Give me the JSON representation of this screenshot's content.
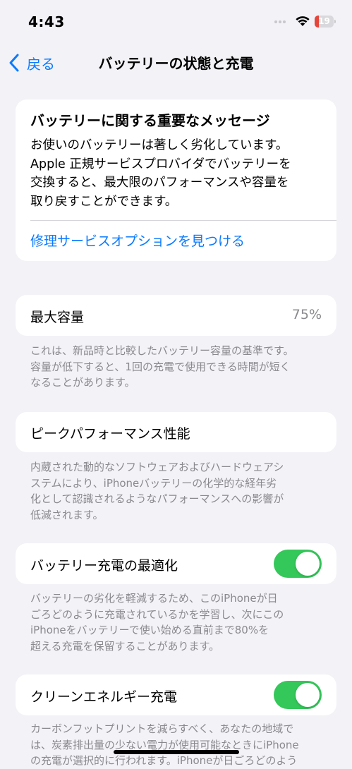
{
  "status_bar": {
    "time": "4:43",
    "battery_level": "19"
  },
  "nav": {
    "back_label": "戻る",
    "title": "バッテリーの状態と充電"
  },
  "message_card": {
    "title": "バッテリーに関する重要なメッセージ",
    "body_lines": [
      "お使いのバッテリーは著しく劣化しています。",
      "Apple 正規サービスプロバイダでバッテリーを",
      "交換すると、最大限のパフォーマンスや容量を",
      "取り戻すことができます。"
    ],
    "link": "修理サービスオプションを見つける"
  },
  "max_capacity": {
    "label": "最大容量",
    "value": "75%",
    "note_lines": [
      "これは、新品時と比較したバッテリー容量の基準です。",
      "容量が低下すると、1回の充電で使用できる時間が短く",
      "なることがあります。"
    ]
  },
  "peak_performance": {
    "label": "ピークパフォーマンス性能",
    "note_lines": [
      "内蔵された動的なソフトウェアおよびハードウェアシ",
      "ステムにより、iPhoneバッテリーの化学的な経年劣",
      "化として認識されるようなパフォーマンスへの影響が",
      "低減されます。"
    ]
  },
  "optimized_charging": {
    "label": "バッテリー充電の最適化",
    "enabled": true,
    "note_lines": [
      "バッテリーの劣化を軽減するため、このiPhoneが日",
      "ごろどのように充電されているかを学習し、次にこの",
      "iPhoneをバッテリーで使い始める直前まで80%を",
      "超える充電を保留することがあります。"
    ]
  },
  "clean_energy": {
    "label": "クリーンエネルギー充電",
    "enabled": true,
    "note_lines": [
      "カーボンフットプリントを減らすべく、あなたの地域で",
      "は、炭素排出量の少ない電力が使用可能なときにiPhone",
      "の充電が選択的に行われます。iPhoneが日ごろどのよう"
    ]
  },
  "colors": {
    "accent": "#0a7aff",
    "toggle_on": "#34c759",
    "background": "#f2f2f7",
    "battery_low": "#e5453a"
  }
}
